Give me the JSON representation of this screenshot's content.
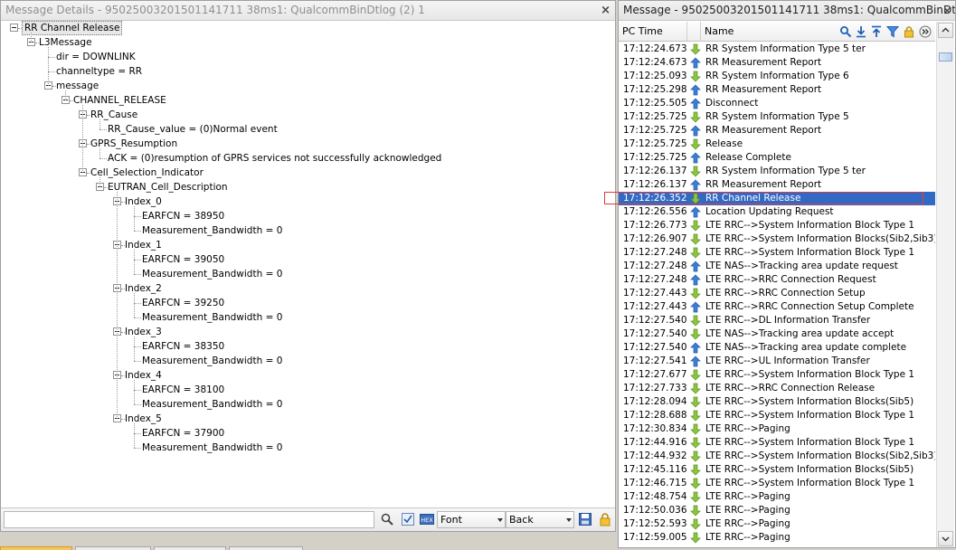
{
  "left_panel": {
    "title": "Message Details - 95025003201501141711 38ms1: QualcommBinDtlog (2) 1",
    "close_glyph": "×",
    "tree": [
      {
        "level": 0,
        "label": "RR Channel Release",
        "expandable": true
      },
      {
        "level": 1,
        "label": "L3Message",
        "expandable": true
      },
      {
        "level": 2,
        "label": "dir = DOWNLINK",
        "expandable": false
      },
      {
        "level": 2,
        "label": "channeltype = RR",
        "expandable": false
      },
      {
        "level": 2,
        "label": "message",
        "expandable": true
      },
      {
        "level": 3,
        "label": "CHANNEL_RELEASE",
        "expandable": true
      },
      {
        "level": 4,
        "label": "RR_Cause",
        "expandable": true
      },
      {
        "level": 5,
        "label": "RR_Cause_value =  (0)Normal event",
        "expandable": false
      },
      {
        "level": 4,
        "label": "GPRS_Resumption",
        "expandable": true
      },
      {
        "level": 5,
        "label": "ACK =  (0)resumption of GPRS services not successfully acknowledged",
        "expandable": false
      },
      {
        "level": 4,
        "label": "Cell_Selection_Indicator",
        "expandable": true
      },
      {
        "level": 5,
        "label": "EUTRAN_Cell_Description",
        "expandable": true
      },
      {
        "level": 6,
        "label": "Index_0",
        "expandable": true
      },
      {
        "level": 7,
        "label": "EARFCN = 38950",
        "expandable": false
      },
      {
        "level": 7,
        "label": "Measurement_Bandwidth = 0",
        "expandable": false
      },
      {
        "level": 6,
        "label": "Index_1",
        "expandable": true
      },
      {
        "level": 7,
        "label": "EARFCN = 39050",
        "expandable": false
      },
      {
        "level": 7,
        "label": "Measurement_Bandwidth = 0",
        "expandable": false
      },
      {
        "level": 6,
        "label": "Index_2",
        "expandable": true
      },
      {
        "level": 7,
        "label": "EARFCN = 39250",
        "expandable": false
      },
      {
        "level": 7,
        "label": "Measurement_Bandwidth = 0",
        "expandable": false
      },
      {
        "level": 6,
        "label": "Index_3",
        "expandable": true
      },
      {
        "level": 7,
        "label": "EARFCN = 38350",
        "expandable": false
      },
      {
        "level": 7,
        "label": "Measurement_Bandwidth = 0",
        "expandable": false
      },
      {
        "level": 6,
        "label": "Index_4",
        "expandable": true
      },
      {
        "level": 7,
        "label": "EARFCN = 38100",
        "expandable": false
      },
      {
        "level": 7,
        "label": "Measurement_Bandwidth = 0",
        "expandable": false
      },
      {
        "level": 6,
        "label": "Index_5",
        "expandable": true
      },
      {
        "level": 7,
        "label": "EARFCN = 37900",
        "expandable": false
      },
      {
        "level": 7,
        "label": "Measurement_Bandwidth = 0",
        "expandable": false
      }
    ],
    "toolbar": {
      "search_value": "",
      "font_label": "Font",
      "back_label": "Back",
      "hex_label": "HEX"
    }
  },
  "right_panel": {
    "title": "Message - 95025003201501141711 38ms1: QualcommBinDt...",
    "close_glyph": "×",
    "columns": {
      "time": "PC Time",
      "name": "Name"
    },
    "selected_index": 11,
    "messages": [
      {
        "time": "17:12:24.673",
        "dir": "down",
        "name": "RR System Information Type 5 ter"
      },
      {
        "time": "17:12:24.673",
        "dir": "up",
        "name": "RR Measurement Report"
      },
      {
        "time": "17:12:25.093",
        "dir": "down",
        "name": "RR System Information Type 6"
      },
      {
        "time": "17:12:25.298",
        "dir": "up",
        "name": "RR Measurement Report"
      },
      {
        "time": "17:12:25.505",
        "dir": "up",
        "name": "Disconnect"
      },
      {
        "time": "17:12:25.725",
        "dir": "down",
        "name": "RR System Information Type 5"
      },
      {
        "time": "17:12:25.725",
        "dir": "up",
        "name": "RR Measurement Report"
      },
      {
        "time": "17:12:25.725",
        "dir": "down",
        "name": "Release"
      },
      {
        "time": "17:12:25.725",
        "dir": "up",
        "name": "Release Complete"
      },
      {
        "time": "17:12:26.137",
        "dir": "down",
        "name": "RR System Information Type 5 ter"
      },
      {
        "time": "17:12:26.137",
        "dir": "up",
        "name": "RR Measurement Report"
      },
      {
        "time": "17:12:26.352",
        "dir": "down",
        "name": "RR Channel Release"
      },
      {
        "time": "17:12:26.556",
        "dir": "up",
        "name": "Location Updating Request"
      },
      {
        "time": "17:12:26.773",
        "dir": "down",
        "name": "LTE RRC-->System Information Block Type 1"
      },
      {
        "time": "17:12:26.907",
        "dir": "down",
        "name": "LTE RRC-->System Information Blocks(Sib2,Sib3)"
      },
      {
        "time": "17:12:27.248",
        "dir": "down",
        "name": "LTE RRC-->System Information Block Type 1"
      },
      {
        "time": "17:12:27.248",
        "dir": "up",
        "name": "LTE NAS-->Tracking area update request"
      },
      {
        "time": "17:12:27.248",
        "dir": "up",
        "name": "LTE RRC-->RRC Connection Request"
      },
      {
        "time": "17:12:27.443",
        "dir": "down",
        "name": "LTE RRC-->RRC Connection Setup"
      },
      {
        "time": "17:12:27.443",
        "dir": "up",
        "name": "LTE RRC-->RRC Connection Setup Complete"
      },
      {
        "time": "17:12:27.540",
        "dir": "down",
        "name": "LTE RRC-->DL Information Transfer"
      },
      {
        "time": "17:12:27.540",
        "dir": "down",
        "name": "LTE NAS-->Tracking area update accept"
      },
      {
        "time": "17:12:27.540",
        "dir": "up",
        "name": "LTE NAS-->Tracking area update complete"
      },
      {
        "time": "17:12:27.541",
        "dir": "up",
        "name": "LTE RRC-->UL Information Transfer"
      },
      {
        "time": "17:12:27.677",
        "dir": "down",
        "name": "LTE RRC-->System Information Block Type 1"
      },
      {
        "time": "17:12:27.733",
        "dir": "down",
        "name": "LTE RRC-->RRC Connection Release"
      },
      {
        "time": "17:12:28.094",
        "dir": "down",
        "name": "LTE RRC-->System Information Blocks(Sib5)"
      },
      {
        "time": "17:12:28.688",
        "dir": "down",
        "name": "LTE RRC-->System Information Block Type 1"
      },
      {
        "time": "17:12:30.834",
        "dir": "down",
        "name": "LTE RRC-->Paging"
      },
      {
        "time": "17:12:44.916",
        "dir": "down",
        "name": "LTE RRC-->System Information Block Type 1"
      },
      {
        "time": "17:12:44.932",
        "dir": "down",
        "name": "LTE RRC-->System Information Blocks(Sib2,Sib3)"
      },
      {
        "time": "17:12:45.116",
        "dir": "down",
        "name": "LTE RRC-->System Information Blocks(Sib5)"
      },
      {
        "time": "17:12:46.715",
        "dir": "down",
        "name": "LTE RRC-->System Information Block Type 1"
      },
      {
        "time": "17:12:48.754",
        "dir": "down",
        "name": "LTE RRC-->Paging"
      },
      {
        "time": "17:12:50.036",
        "dir": "down",
        "name": "LTE RRC-->Paging"
      },
      {
        "time": "17:12:52.593",
        "dir": "down",
        "name": "LTE RRC-->Paging"
      },
      {
        "time": "17:12:59.005",
        "dir": "down",
        "name": "LTE RRC-->Paging"
      }
    ],
    "colors": {
      "downlink_arrow": "#8cc63f",
      "uplink_arrow": "#3a7fd5",
      "selection": "#316ac5",
      "selection_outline": "#e23a3a"
    },
    "header_icons": [
      "search-icon",
      "download-icon",
      "upload-icon",
      "filter-icon",
      "lock-icon",
      "more-icon"
    ]
  }
}
